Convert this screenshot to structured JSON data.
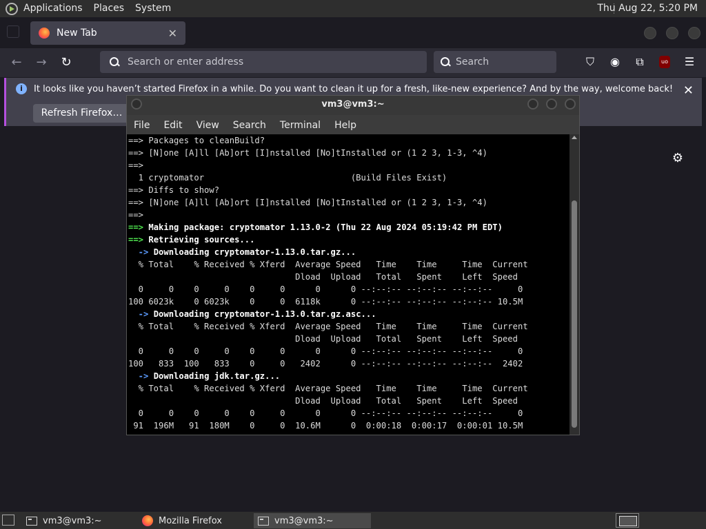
{
  "top_panel": {
    "menus": [
      "Applications",
      "Places",
      "System"
    ],
    "clock": "Thu Aug 22,  5:20 PM"
  },
  "firefox": {
    "tab": {
      "label": "New Tab"
    },
    "urlbar_placeholder": "Search or enter address",
    "search_placeholder": "Search",
    "notification": {
      "message": "It looks like you haven’t started Firefox in a while. Do you want to clean it up for a fresh, like-new experience? And by the way, welcome back!",
      "button": "Refresh Firefox…"
    }
  },
  "terminal": {
    "title": "vm3@vm3:~",
    "menu": [
      "File",
      "Edit",
      "View",
      "Search",
      "Terminal",
      "Help"
    ],
    "lines": [
      {
        "t": "==> Packages to cleanBuild?",
        "c": ""
      },
      {
        "t": "==> [N]one [A]ll [Ab]ort [I]nstalled [No]tInstalled or (1 2 3, 1-3, ^4)",
        "c": ""
      },
      {
        "t": "==>",
        "c": ""
      },
      {
        "t": "  1 cryptomator                             (Build Files Exist)",
        "c": ""
      },
      {
        "t": "==> Diffs to show?",
        "c": ""
      },
      {
        "t": "==> [N]one [A]ll [Ab]ort [I]nstalled [No]tInstalled or (1 2 3, 1-3, ^4)",
        "c": ""
      },
      {
        "t": "==>",
        "c": ""
      },
      {
        "t": "==> Making package: cryptomator 1.13.0-2 (Thu 22 Aug 2024 05:19:42 PM EDT)",
        "c": "grn"
      },
      {
        "t": "==> Retrieving sources...",
        "c": "grn"
      },
      {
        "t": "  -> Downloading cryptomator-1.13.0.tar.gz...",
        "c": "blue"
      },
      {
        "t": "  % Total    % Received % Xferd  Average Speed   Time    Time     Time  Current",
        "c": ""
      },
      {
        "t": "                                 Dload  Upload   Total   Spent    Left  Speed",
        "c": ""
      },
      {
        "t": "  0     0    0     0    0     0      0      0 --:--:-- --:--:-- --:--:--     0",
        "c": ""
      },
      {
        "t": "100 6023k    0 6023k    0     0  6118k      0 --:--:-- --:--:-- --:--:-- 10.5M",
        "c": ""
      },
      {
        "t": "  -> Downloading cryptomator-1.13.0.tar.gz.asc...",
        "c": "blue"
      },
      {
        "t": "  % Total    % Received % Xferd  Average Speed   Time    Time     Time  Current",
        "c": ""
      },
      {
        "t": "                                 Dload  Upload   Total   Spent    Left  Speed",
        "c": ""
      },
      {
        "t": "  0     0    0     0    0     0      0      0 --:--:-- --:--:-- --:--:--     0",
        "c": ""
      },
      {
        "t": "100   833  100   833    0     0   2402      0 --:--:-- --:--:-- --:--:--  2402",
        "c": ""
      },
      {
        "t": "  -> Downloading jdk.tar.gz...",
        "c": "blue"
      },
      {
        "t": "  % Total    % Received % Xferd  Average Speed   Time    Time     Time  Current",
        "c": ""
      },
      {
        "t": "                                 Dload  Upload   Total   Spent    Left  Speed",
        "c": ""
      },
      {
        "t": "  0     0    0     0    0     0      0      0 --:--:-- --:--:-- --:--:--     0",
        "c": ""
      },
      {
        "t": " 91  196M   91  180M    0     0  10.6M      0  0:00:18  0:00:17  0:00:01 10.5M",
        "c": ""
      }
    ]
  },
  "taskbar": {
    "tasks": [
      {
        "label": "vm3@vm3:~",
        "icon": "terminal-icon"
      },
      {
        "label": "Mozilla Firefox",
        "icon": "firefox-icon"
      },
      {
        "label": "vm3@vm3:~",
        "icon": "terminal-icon"
      }
    ]
  }
}
